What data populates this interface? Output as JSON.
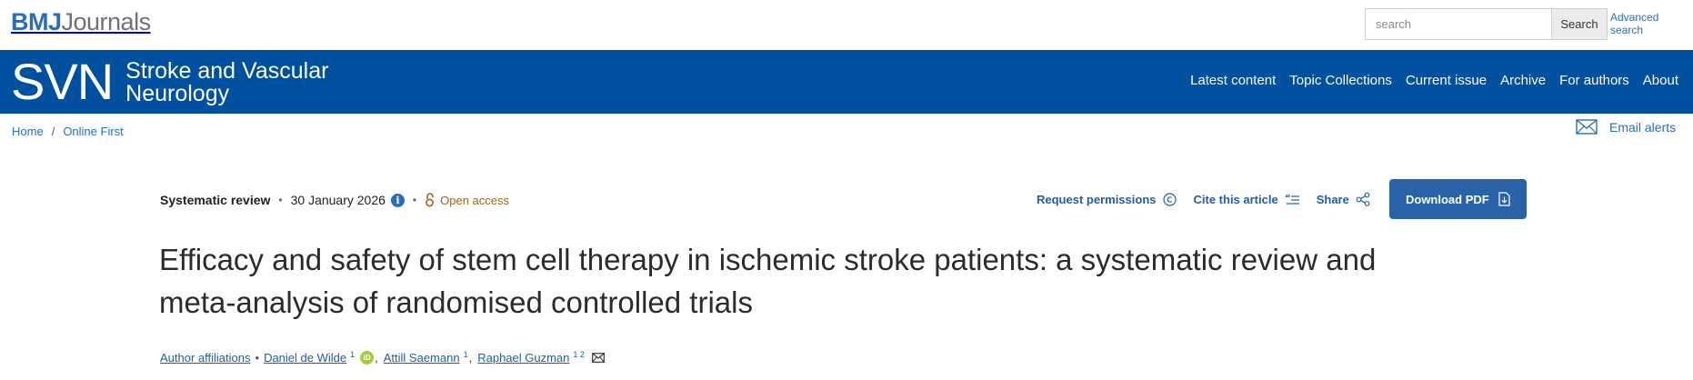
{
  "header": {
    "logo_bmj": "BMJ",
    "logo_journals": "Journals",
    "search_placeholder": "search",
    "search_button": "Search",
    "advanced_search": "Advanced search"
  },
  "journal": {
    "abbrev": "SVN",
    "name_line1": "Stroke and Vascular",
    "name_line2": "Neurology",
    "band_color": "#0050a0"
  },
  "nav": {
    "items": [
      "Latest content",
      "Topic Collections",
      "Current issue",
      "Archive",
      "For authors",
      "About"
    ]
  },
  "breadcrumb": {
    "items": [
      "Home",
      "Online First"
    ],
    "separator": "/"
  },
  "email_alerts": "Email alerts",
  "article": {
    "type": "Systematic review",
    "date": "30 January 2026",
    "info_icon": "i",
    "open_access": "Open access",
    "actions": {
      "request_permissions": "Request permissions",
      "cite": "Cite this article",
      "share": "Share",
      "download": "Download PDF"
    },
    "title": "Efficacy and safety of stem cell therapy in ischemic stroke patients: a systematic review and meta-analysis of randomised controlled trials",
    "author_affiliations": "Author affiliations",
    "authors": [
      {
        "name": "Daniel de Wilde",
        "sup": "1",
        "orcid": true
      },
      {
        "name": "Attill Saemann",
        "sup": "1"
      },
      {
        "name": "Raphael Guzman",
        "sup": "1 2",
        "email": true
      }
    ],
    "orcid_label": "iD"
  }
}
